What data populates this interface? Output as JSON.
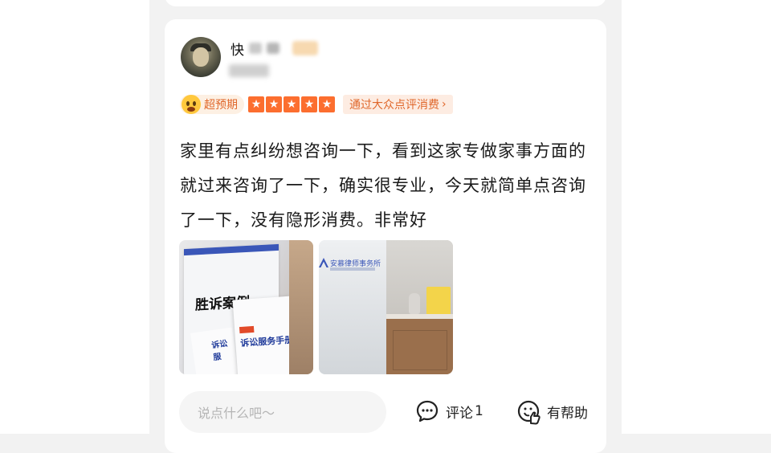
{
  "review": {
    "user": {
      "name_visible": "快"
    },
    "tags": {
      "expectation_label": "超预期",
      "star_count": 5,
      "source_label": "通过大众点评消费",
      "source_chevron": "›"
    },
    "text": "家里有点纠纷想咨询一下，看到这家专做家事方面的就过来咨询了一下，确实很专业，今天就简单点咨询了一下，没有隐形消费。非常好",
    "photos": [
      {
        "book_title": "胜诉案例",
        "front_title": "诉讼服务手册",
        "left_title": "诉讼服"
      },
      {
        "logo_text": "安慕律师事务所"
      }
    ]
  },
  "actions": {
    "comment_placeholder": "说点什么吧～",
    "comment_label": "评论",
    "comment_count": "1",
    "helpful_label": "有帮助"
  },
  "colors": {
    "accent": "#fc6e2f",
    "tag_text": "#e0672b"
  }
}
